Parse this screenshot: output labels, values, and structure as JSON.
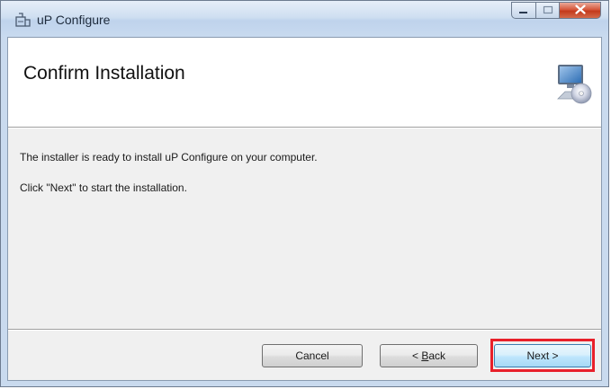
{
  "window": {
    "title": "uP Configure",
    "controls": {
      "minimize_icon": "minimize-icon",
      "maximize_icon": "maximize-icon",
      "close_label": "x"
    }
  },
  "header": {
    "title": "Confirm Installation",
    "graphic_icon": "computer-disc-icon"
  },
  "body": {
    "line1": "The installer is ready to install uP Configure on your computer.",
    "line2": "Click \"Next\" to start the installation."
  },
  "buttons": {
    "cancel": "Cancel",
    "back_prefix": "< ",
    "back_mnemonic": "B",
    "back_rest": "ack",
    "next": "Next >"
  },
  "colors": {
    "highlight": "#e8202a",
    "close_button": "#c33a1c",
    "client_bg": "#f0f0f0"
  }
}
